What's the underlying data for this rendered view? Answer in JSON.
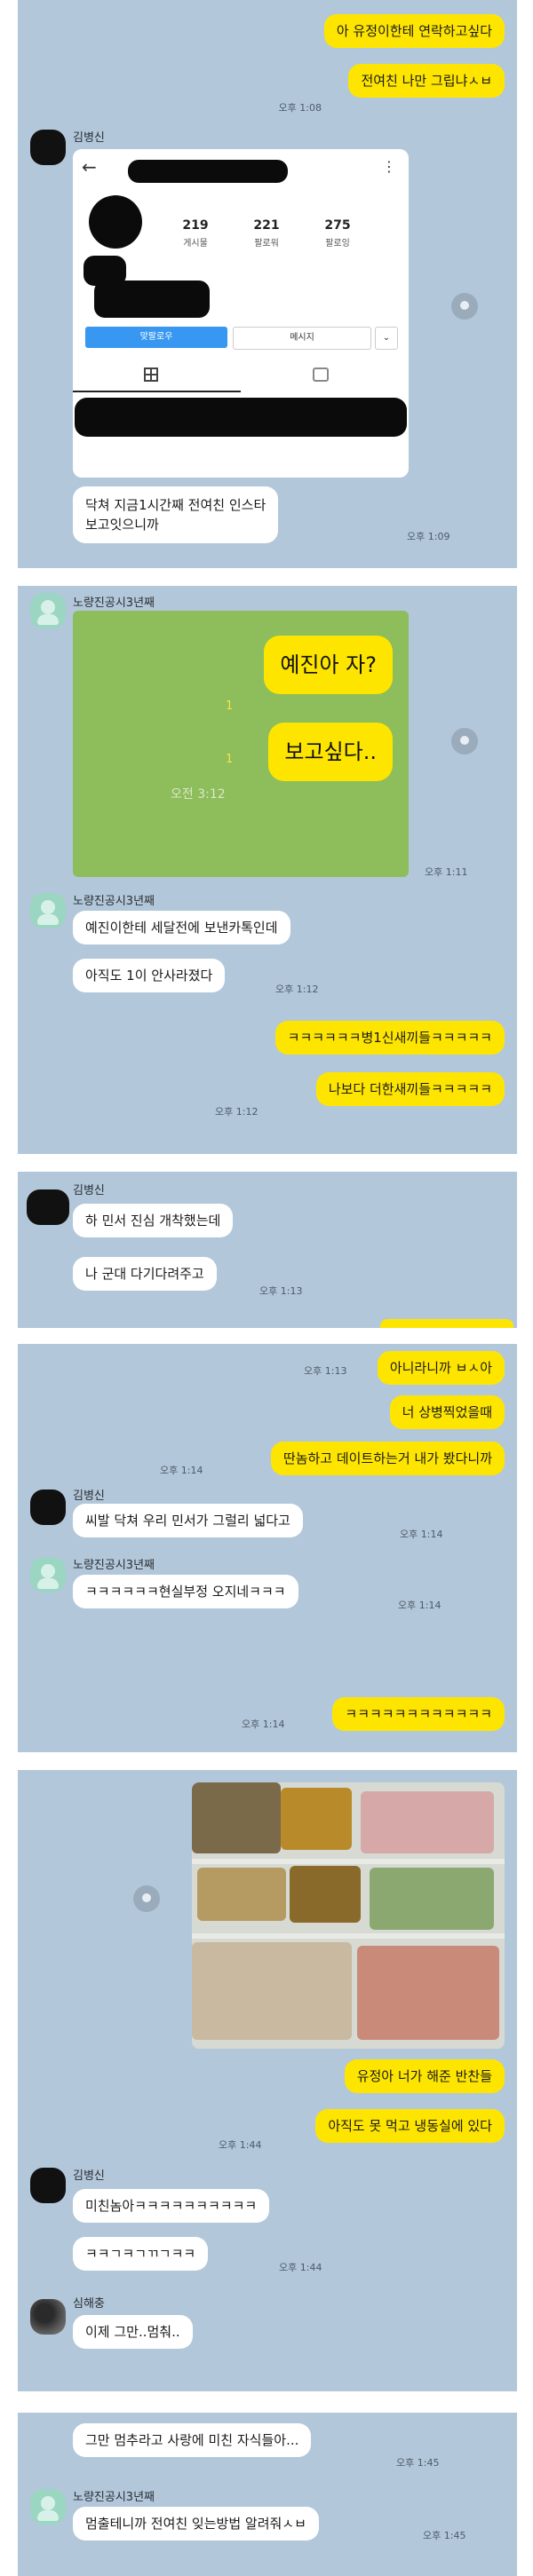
{
  "panel1": {
    "msg1": "아 유정이한테 연락하고싶다",
    "msg2": "전여친 나만 그립냐ㅅㅂ",
    "time1": "오후 1:08",
    "sender": "김병신",
    "insta": {
      "posts_n": "219",
      "posts_l": "게시물",
      "followers_n": "221",
      "followers_l": "팔로워",
      "following_n": "275",
      "following_l": "팔로잉",
      "follow_back": "맞팔로우",
      "message": "메시지"
    },
    "caption": "닥쳐 지금1시간째 전여친 인스타\n보고잇으니까",
    "time2": "오후 1:09"
  },
  "panel2": {
    "sender": "노량진공시3년째",
    "card_msg1": "예진아 자?",
    "card_msg2": "보고싶다..",
    "card_unread": "1",
    "card_time": "오전 3:12",
    "time_card": "오후 1:11",
    "msg3": "예진이한테 세달전에 보낸카톡인데",
    "msg4": "아직도 1이 안사라졌다",
    "time3": "오후 1:12",
    "msg5": "ㅋㅋㅋㅋㅋㅋ병1신새끼들ㅋㅋㅋㅋㅋ",
    "msg6": "나보다 더한새끼들ㅋㅋㅋㅋㅋ",
    "time4": "오후 1:12"
  },
  "panel3": {
    "sender": "김병신",
    "msg1": "하 민서 진심 개착했는데",
    "msg2": "나 군대 다기다려주고",
    "time1": "오후 1:13"
  },
  "panel4": {
    "time1": "오후 1:13",
    "msg1": "아니라니까 ㅂㅅ아",
    "msg2": "너 상병찍었을때",
    "msg3": "딴놈하고 데이트하는거 내가 봤다니까",
    "time2": "오후 1:14",
    "sender1": "김병신",
    "msg4": "씨발 닥쳐 우리 민서가 그럴리 넓다고",
    "time3": "오후 1:14",
    "sender2": "노량진공시3년째",
    "msg5": "ㅋㅋㅋㅋㅋㅋ현실부정 오지네ㅋㅋㅋ",
    "time4": "오후 1:14",
    "msg6": "ㅋㅋㅋㅋㅋㅋㅋㅋㅋㅋㅋㅋ",
    "time5": "오후 1:14"
  },
  "panel5": {
    "msg1": "유정아 너가 해준 반찬들",
    "msg2": "아직도 못 먹고 냉동실에 있다",
    "time1": "오후 1:44",
    "sender1": "김병신",
    "msg3": "미친놈아ㅋㅋㅋㅋㅋㅋㅋㅋㅋㅋ",
    "msg4": "ㅋㅋㄱㅋㄱㄲㄱㅋㅋ",
    "time2": "오후 1:44",
    "sender2": "심해충",
    "msg5": "이제 그만..멈춰.."
  },
  "panel6": {
    "msg1": "그만 멈추라고 사랑에 미친 자식들아...",
    "time1": "오후 1:45",
    "sender": "노량진공시3년째",
    "msg2": "멈출테니까 전여친 잊는방법 알려줘ㅅㅂ",
    "time2": "오후 1:45"
  }
}
